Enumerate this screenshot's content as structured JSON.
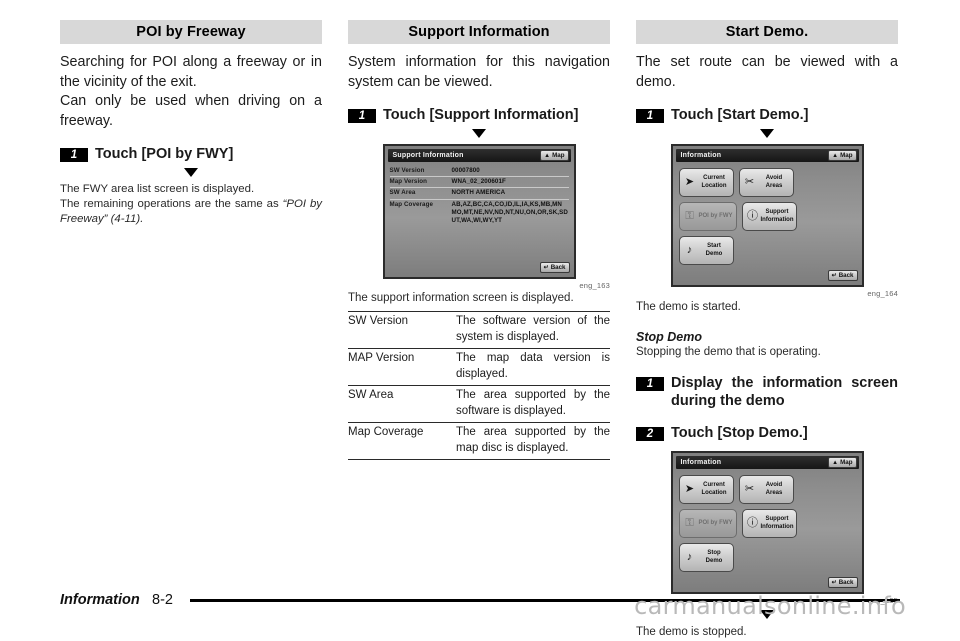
{
  "columns": {
    "left": {
      "header": "POI by Freeway",
      "lead": [
        "Searching for POI along a freeway or in the vicinity of the exit.",
        "Can only be used when driving on a freeway."
      ],
      "step": {
        "number": "1",
        "text": "Touch [POI by FWY]"
      },
      "notes": [
        "The FWY area list screen is displayed.",
        "The remaining operations are the same as ",
        "“POI by Freeway” (4-11)",
        "."
      ]
    },
    "mid": {
      "header": "Support Information",
      "lead": [
        "System information for this navigation system can be viewed."
      ],
      "step": {
        "number": "1",
        "text": "Touch [Support Information]"
      },
      "screenshot": {
        "caption": "eng_163",
        "title": "Support Information",
        "map_button": "Map",
        "map_icon": "▲",
        "back_button": "Back",
        "back_icon": "↵",
        "rows": [
          {
            "key": "SW Version",
            "values": [
              "00007800"
            ]
          },
          {
            "key": "Map Version",
            "values": [
              "WNA_02_200601F"
            ]
          },
          {
            "key": "SW Area",
            "values": [
              "NORTH AMERICA"
            ]
          },
          {
            "key": "Map Coverage",
            "values": [
              "AB,AZ,BC,CA,CO,ID,IL,IA,KS,MB,MN",
              "MO,MT,NE,NV,ND,NT,NU,ON,OR,SK,SD",
              "UT,WA,WI,WY,YT"
            ]
          }
        ]
      },
      "after_shot": "The support information screen is displayed.",
      "table": [
        {
          "term": "SW Version",
          "desc": "The software version of the system is displayed."
        },
        {
          "term": "MAP Version",
          "desc": "The map data version is displayed."
        },
        {
          "term": "SW Area",
          "desc": "The area supported by the software is displayed."
        },
        {
          "term": "Map Coverage",
          "desc": "The area supported by the map disc is displayed."
        }
      ]
    },
    "right": {
      "header": "Start Demo.",
      "lead": [
        "The set route can be viewed with a demo."
      ],
      "step1": {
        "number": "1",
        "text": "Touch [Start Demo.]"
      },
      "screenshot1": {
        "caption": "eng_164",
        "title": "Information",
        "map_button": "Map",
        "map_icon": "▲",
        "back_button": "Back",
        "back_icon": "↵",
        "buttons": [
          {
            "name": "current-location",
            "icon": "➤",
            "lines": [
              "Current",
              "Location"
            ],
            "dim": false
          },
          {
            "name": "avoid-areas",
            "icon": "✂",
            "lines": [
              "Avoid",
              "Areas"
            ],
            "dim": false
          },
          {
            "name": "poi-by-fwy",
            "icon": "⚿",
            "lines": [
              "POI by FWY"
            ],
            "dim": true
          },
          {
            "name": "support-information",
            "icon": "ⓘ",
            "lines": [
              "Support",
              "Information"
            ],
            "dim": false
          },
          {
            "name": "start-demo",
            "icon": "♪",
            "lines": [
              "Start",
              "Demo"
            ],
            "dim": false
          }
        ]
      },
      "after_shot1": "The demo is started.",
      "subhead": "Stop Demo",
      "sub_lead": "Stopping the demo that is operating.",
      "step2": {
        "number": "1",
        "text": "Display the information screen during the demo"
      },
      "step3": {
        "number": "2",
        "text": "Touch [Stop Demo.]"
      },
      "screenshot2": {
        "caption": "eng_165",
        "title": "Information",
        "map_button": "Map",
        "map_icon": "▲",
        "back_button": "Back",
        "back_icon": "↵",
        "buttons": [
          {
            "name": "current-location",
            "icon": "➤",
            "lines": [
              "Current",
              "Location"
            ],
            "dim": false
          },
          {
            "name": "avoid-areas",
            "icon": "✂",
            "lines": [
              "Avoid",
              "Areas"
            ],
            "dim": false
          },
          {
            "name": "poi-by-fwy",
            "icon": "⚿",
            "lines": [
              "POI by FWY"
            ],
            "dim": true
          },
          {
            "name": "support-information",
            "icon": "ⓘ",
            "lines": [
              "Support",
              "Information"
            ],
            "dim": false
          },
          {
            "name": "stop-demo",
            "icon": "♪",
            "lines": [
              "Stop",
              "Demo"
            ],
            "dim": false
          }
        ]
      },
      "after_shot2": "The demo is stopped."
    }
  },
  "footer": {
    "section": "Information",
    "page": "8-2",
    "watermark": "carmanualsonline.info"
  }
}
